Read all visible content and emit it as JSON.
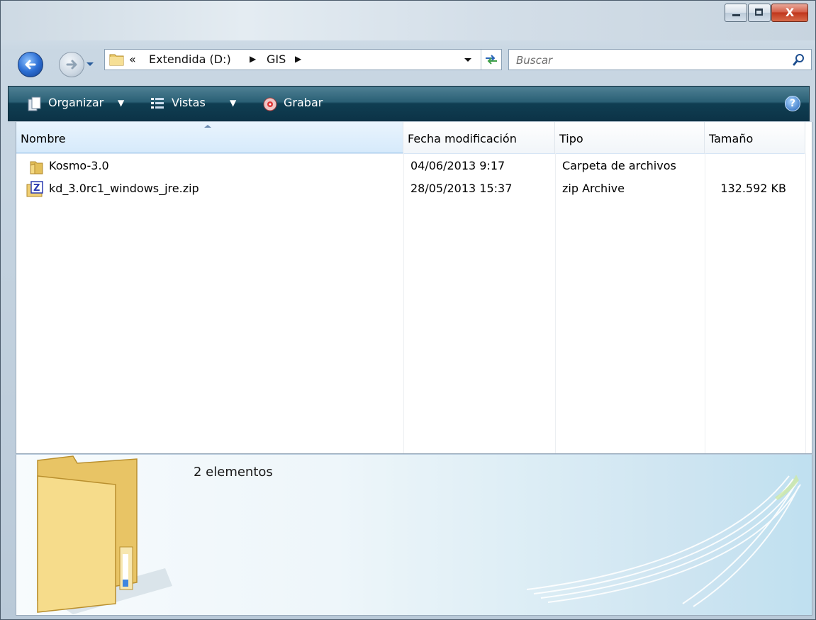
{
  "window": {
    "controls": {
      "minimize": "minimize",
      "maximize": "maximize",
      "close": "X"
    }
  },
  "address": {
    "overflow": "«",
    "crumbs": [
      "Extendida (D:)",
      "GIS"
    ]
  },
  "search": {
    "placeholder": "Buscar"
  },
  "toolbar": {
    "organize_label": "Organizar",
    "views_label": "Vistas",
    "burn_label": "Grabar",
    "help_label": "?"
  },
  "columns": {
    "name": "Nombre",
    "date": "Fecha modificación",
    "type": "Tipo",
    "size": "Tamaño"
  },
  "files": [
    {
      "name": "Kosmo-3.0",
      "date": "04/06/2013 9:17",
      "type": "Carpeta de archivos",
      "size": "",
      "icon": "folder-icon"
    },
    {
      "name": "kd_3.0rc1_windows_jre.zip",
      "date": "28/05/2013 15:37",
      "type": "zip Archive",
      "size": "132.592 KB",
      "icon": "zip-file-icon"
    }
  ],
  "details": {
    "count_text": "2 elementos"
  },
  "colors": {
    "toolbar": "#1f5266",
    "selected_header": "#d6eafb",
    "close_button": "#c0361c"
  }
}
